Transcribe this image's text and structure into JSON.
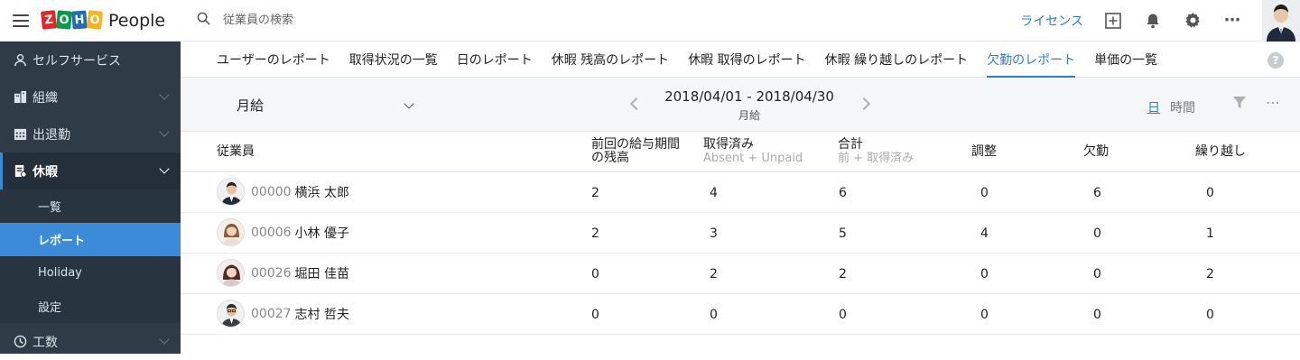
{
  "brand": {
    "logo_letters": [
      "Z",
      "O",
      "H",
      "O"
    ],
    "product": "People"
  },
  "sidebar": {
    "items": [
      {
        "label": "セルフサービス",
        "icon": "user-icon"
      },
      {
        "label": "組織",
        "icon": "building-icon"
      },
      {
        "label": "出退勤",
        "icon": "calendar-icon"
      },
      {
        "label": "休暇",
        "icon": "document-icon",
        "expanded": true
      },
      {
        "label": "工数",
        "icon": "clock-icon"
      }
    ],
    "leave_sub": [
      {
        "label": "一覧"
      },
      {
        "label": "レポート",
        "active": true
      },
      {
        "label": "Holiday"
      },
      {
        "label": "設定"
      }
    ]
  },
  "header": {
    "search_placeholder": "従業員の検索",
    "license": "ライセンス"
  },
  "tabs": [
    {
      "label": "ユーザーのレポート"
    },
    {
      "label": "取得状況の一覧"
    },
    {
      "label": "日のレポート"
    },
    {
      "label": "休暇 残高のレポート"
    },
    {
      "label": "休暇 取得のレポート"
    },
    {
      "label": "休暇 繰り越しのレポート"
    },
    {
      "label": "欠勤のレポート",
      "active": true
    },
    {
      "label": "単価の一覧"
    }
  ],
  "filter": {
    "pay_type": "月給",
    "range": "2018/04/01 - 2018/04/30",
    "range_sub": "月給",
    "view_day": "日",
    "view_hour": "時間"
  },
  "table": {
    "headers": {
      "employee": "従業員",
      "prev_balance_1": "前回の給与期間",
      "prev_balance_2": "の残高",
      "taken": "取得済み",
      "taken_sub": "Absent + Unpaid",
      "total": "合計",
      "total_sub": "前 + 取得済み",
      "adjust": "調整",
      "absent": "欠勤",
      "carry": "繰り越し"
    },
    "rows": [
      {
        "id": "00000",
        "name": "横浜 太郎",
        "prev": "2",
        "taken": "4",
        "total": "6",
        "adjust": "0",
        "absent": "6",
        "carry": "0"
      },
      {
        "id": "00006",
        "name": "小林 優子",
        "prev": "2",
        "taken": "3",
        "total": "5",
        "adjust": "4",
        "absent": "0",
        "carry": "1"
      },
      {
        "id": "00026",
        "name": "堀田 佳苗",
        "prev": "0",
        "taken": "2",
        "total": "2",
        "adjust": "0",
        "absent": "0",
        "carry": "2"
      },
      {
        "id": "00027",
        "name": "志村 哲夫",
        "prev": "0",
        "taken": "0",
        "total": "0",
        "adjust": "0",
        "absent": "0",
        "carry": "0"
      }
    ]
  },
  "colors": {
    "sidebar": "#2f3b47",
    "accent": "#3b8bd9",
    "link": "#2e7dd1"
  }
}
